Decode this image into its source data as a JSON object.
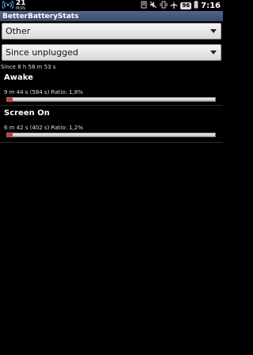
{
  "status_bar": {
    "date_day": "21",
    "date_weekday": "MON",
    "battery_level": "96",
    "time": "7:16",
    "icons": [
      "wifi-tethering-icon",
      "notification-icon",
      "mute-icon",
      "vibrate-icon",
      "airplane-mode-icon"
    ]
  },
  "app": {
    "title": "BetterBatteryStats"
  },
  "filters": {
    "stat_type": "Other",
    "reference": "Since unplugged"
  },
  "since_text": "Since 8 h 58 m 53 s",
  "stats": [
    {
      "title": "Awake",
      "detail": "9 m 44 s  (584 s) Ratio: 1,8%",
      "ratio": 0.018
    },
    {
      "title": "Screen On",
      "detail": "6 m 42 s  (402 s) Ratio: 1,2%",
      "ratio": 0.012
    }
  ],
  "colors": {
    "title_bar": "#3a4a6e",
    "bar_fill": "#e03030"
  }
}
